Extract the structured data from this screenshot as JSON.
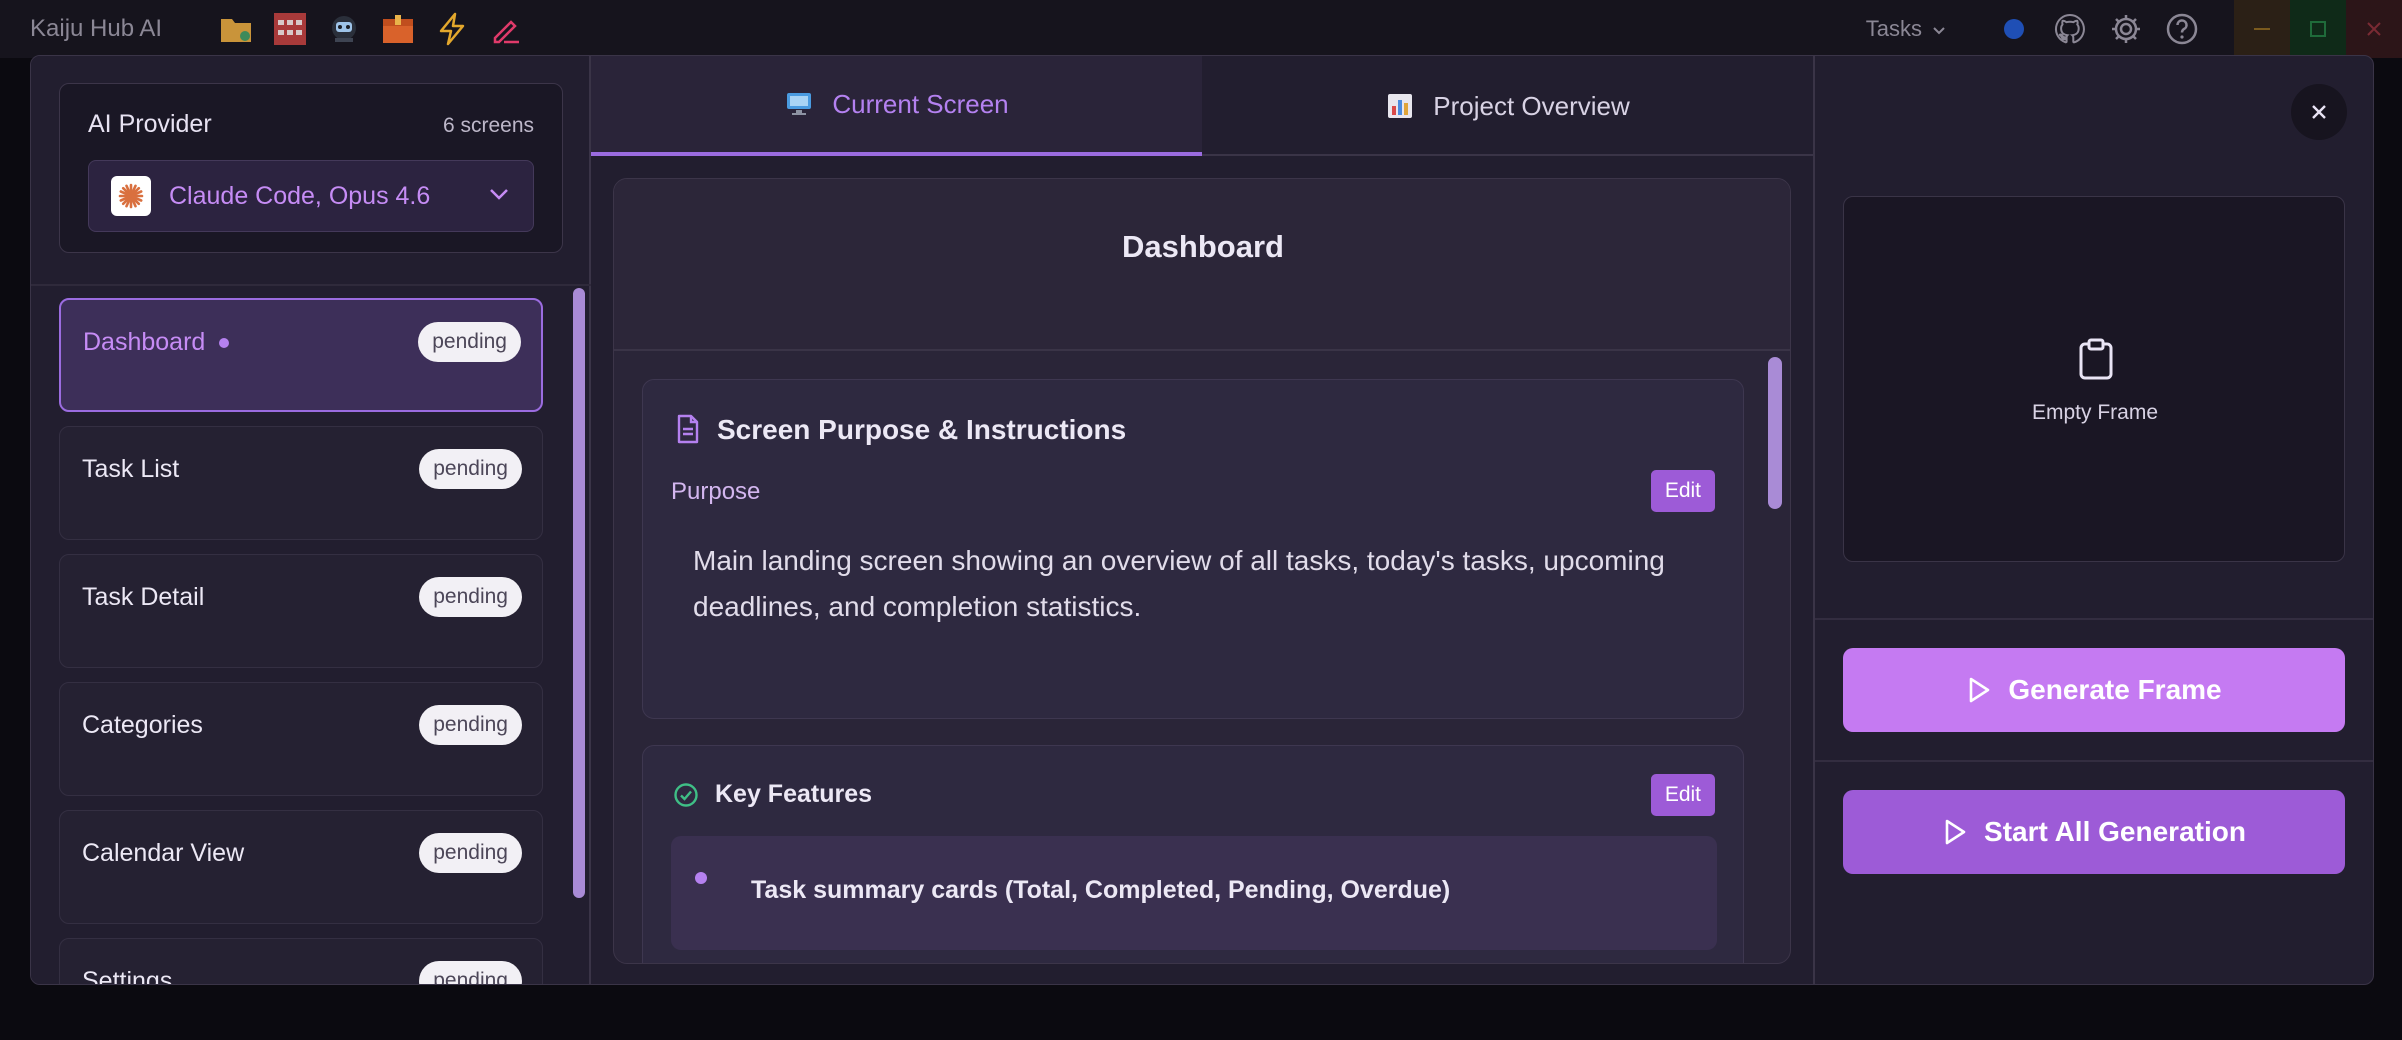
{
  "app": {
    "title": "Kaiju Hub AI",
    "toolbar_icons": [
      "folder-icon",
      "grid-icon",
      "robot-icon",
      "package-icon",
      "bolt-icon",
      "pen-icon"
    ],
    "tasks_label": "Tasks"
  },
  "provider": {
    "title": "AI Provider",
    "screens_count": "6 screens",
    "selected": "Claude Code, Opus 4.6"
  },
  "screens": [
    {
      "name": "Dashboard",
      "status": "pending",
      "active": true
    },
    {
      "name": "Task List",
      "status": "pending",
      "active": false
    },
    {
      "name": "Task Detail",
      "status": "pending",
      "active": false
    },
    {
      "name": "Categories",
      "status": "pending",
      "active": false
    },
    {
      "name": "Calendar View",
      "status": "pending",
      "active": false
    },
    {
      "name": "Settings",
      "status": "pending",
      "active": false
    }
  ],
  "tabs": {
    "current": "Current Screen",
    "overview": "Project Overview"
  },
  "content": {
    "title": "Dashboard",
    "purpose_section_title": "Screen Purpose & Instructions",
    "purpose_label": "Purpose",
    "edit_label": "Edit",
    "purpose_text": "Main landing screen showing an overview of all tasks, today's tasks, upcoming deadlines, and completion statistics.",
    "features_title": "Key Features",
    "features": [
      "Task summary cards (Total, Completed, Pending, Overdue)"
    ]
  },
  "preview": {
    "empty_label": "Empty Frame",
    "generate_label": "Generate Frame",
    "start_all_label": "Start All Generation"
  },
  "colors": {
    "accent": "#9d5bd7",
    "accent_light": "#c57af2",
    "panel_bg": "#221e2f"
  }
}
